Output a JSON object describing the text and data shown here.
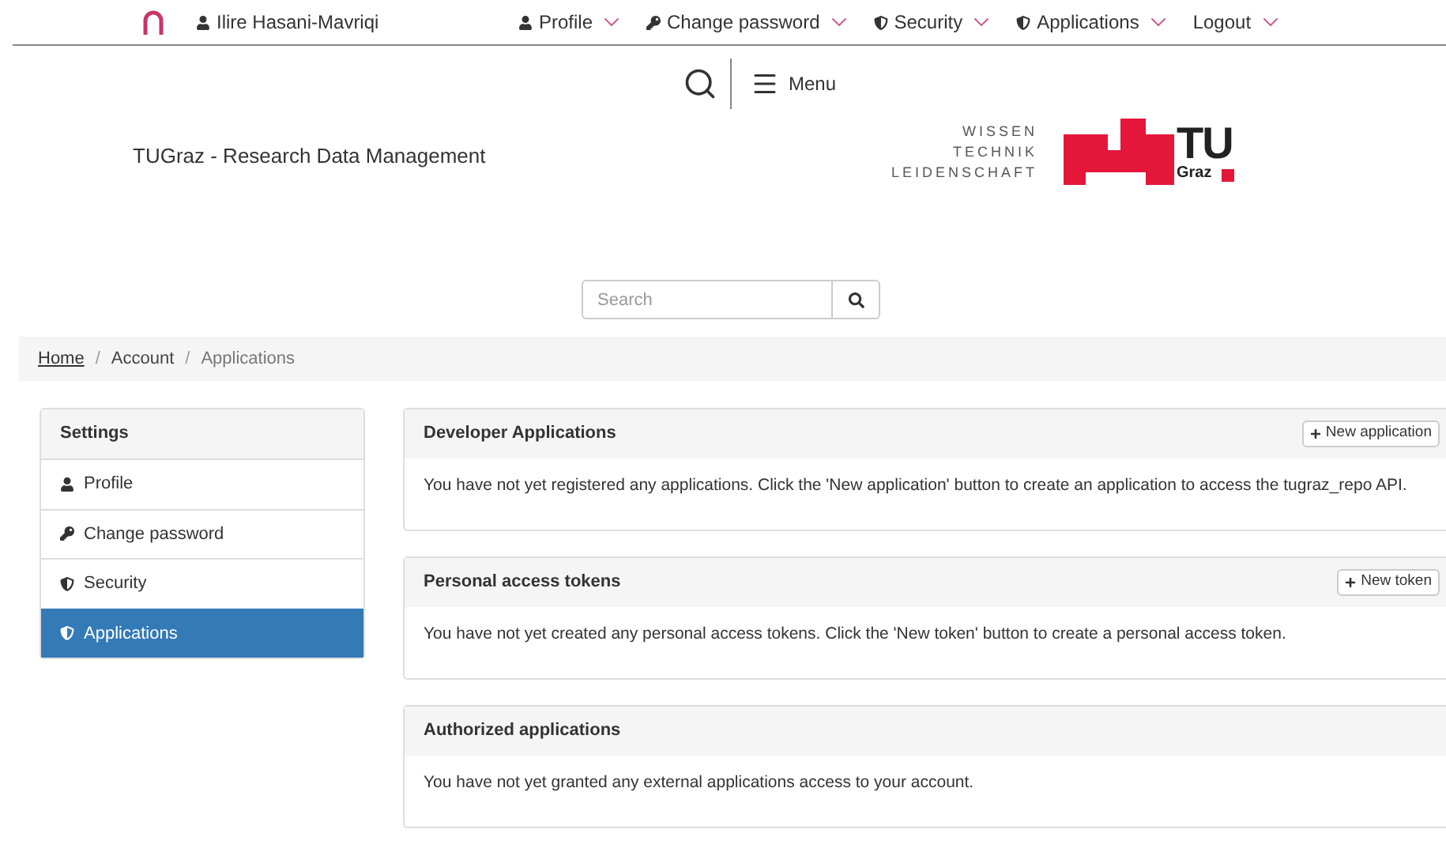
{
  "top_nav": {
    "user": "Ilire Hasani-Mavriqi",
    "items": [
      {
        "label": "Profile",
        "kind": "user"
      },
      {
        "label": "Change password",
        "kind": "key"
      },
      {
        "label": "Security",
        "kind": "shield"
      },
      {
        "label": "Applications",
        "kind": "shield"
      },
      {
        "label": "Logout",
        "kind": "none"
      }
    ]
  },
  "header": {
    "menu": "Menu",
    "site_title": "TUGraz - Research Data Management",
    "logo": {
      "tagline": [
        "WISSEN",
        "TECHNIK",
        "LEIDENSCHAFT"
      ],
      "mark": "TU",
      "sub": "Graz"
    }
  },
  "search": {
    "placeholder": "Search"
  },
  "breadcrumb_separator": "/",
  "breadcrumb": [
    {
      "label": "Home",
      "link": true
    },
    {
      "label": "Account",
      "link": false
    },
    {
      "label": "Applications",
      "link": false
    }
  ],
  "sidebar": {
    "title": "Settings",
    "items": [
      {
        "label": "Profile",
        "kind": "user",
        "selected": false
      },
      {
        "label": "Change password",
        "kind": "key",
        "selected": false
      },
      {
        "label": "Security",
        "kind": "shield",
        "selected": false
      },
      {
        "label": "Applications",
        "kind": "shield",
        "selected": true
      }
    ]
  },
  "panels": [
    {
      "title": "Developer Applications",
      "button": "New application",
      "text": "You have not yet registered any applications. Click the 'New application' button to create an application to access the tugraz_repo API."
    },
    {
      "title": "Personal access tokens",
      "button": "New token",
      "text": "You have not yet created any personal access tokens. Click the 'New token' button to create a personal access token."
    },
    {
      "title": "Authorized applications",
      "text": "You have not yet granted any external applications access to your account."
    }
  ]
}
